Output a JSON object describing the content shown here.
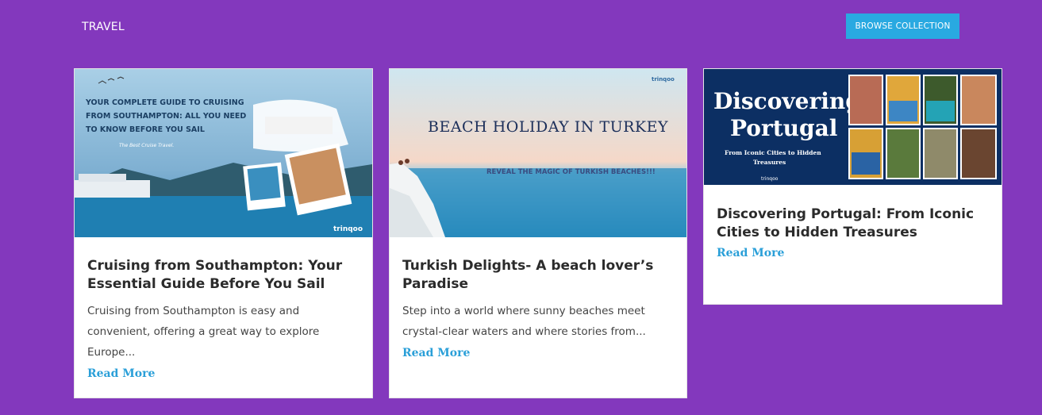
{
  "section": {
    "title": "TRAVEL",
    "browse_label": "BROWSE COLLECTION"
  },
  "colors": {
    "background": "#8338bd",
    "accent": "#29a9e1",
    "link": "#2a9fd8"
  },
  "cards": [
    {
      "title": "Cruising from Southampton: Your Essential Guide Before You Sail",
      "excerpt": "Cruising from Southampton is easy and convenient, offering a great way to explore Europe...",
      "read_more": "Read More",
      "image": {
        "headline": "YOUR COMPLETE GUIDE TO CRUISING FROM SOUTHAMPTON: ALL YOU NEED TO KNOW BEFORE YOU SAIL",
        "subline": "The Best Cruise Travel.",
        "brand": "trinqoo"
      }
    },
    {
      "title": "Turkish Delights- A beach lover’s Paradise",
      "excerpt": "Step into a world where sunny beaches meet crystal-clear waters and where stories from...",
      "read_more": "Read More",
      "image": {
        "headline": "BEACH HOLIDAY IN TURKEY",
        "subline": "REVEAL THE MAGIC OF TURKISH BEACHES!!!",
        "brand": "trinqoo"
      }
    },
    {
      "title": "Discovering Portugal: From Iconic Cities to Hidden Treasures",
      "read_more": "Read More",
      "image": {
        "headline": "Discovering Portugal",
        "subline": "From Iconic Cities to Hidden Treasures",
        "brand": "trinqoo"
      }
    }
  ]
}
